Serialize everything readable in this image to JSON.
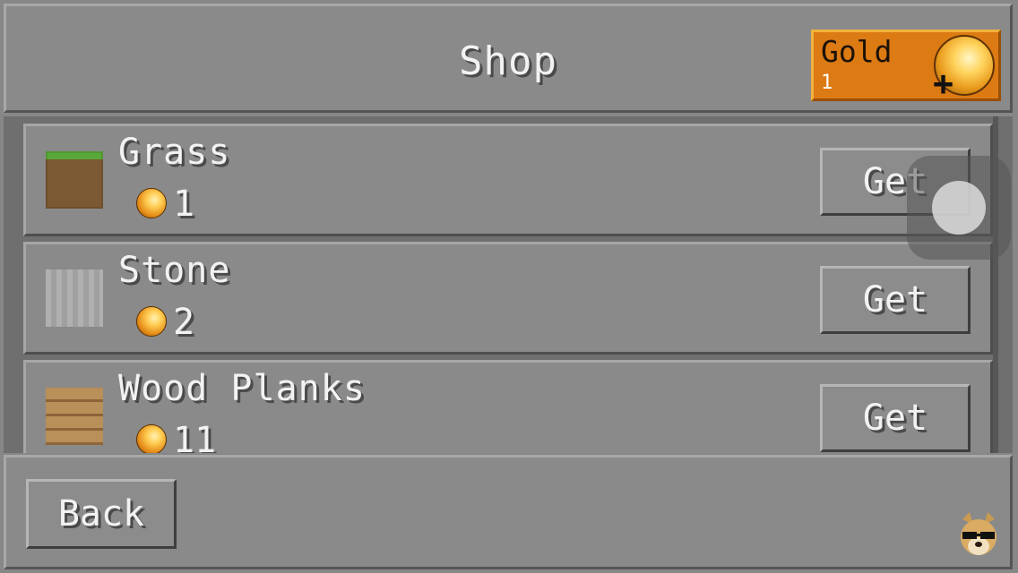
{
  "header": {
    "title": "Shop",
    "gold": {
      "label": "Gold",
      "amount": "1",
      "plus": "+"
    }
  },
  "items": [
    {
      "name": "Grass",
      "price": "1",
      "icon": "grass-block-icon",
      "button": "Get"
    },
    {
      "name": "Stone",
      "price": "2",
      "icon": "stone-block-icon",
      "button": "Get"
    },
    {
      "name": "Wood Planks",
      "price": "11",
      "icon": "wood-planks-icon",
      "button": "Get"
    }
  ],
  "footer": {
    "back_label": "Back"
  },
  "colors": {
    "panel": "#8a8a8a",
    "gold_box": "#dc7a14",
    "text": "#f2f2f2"
  }
}
